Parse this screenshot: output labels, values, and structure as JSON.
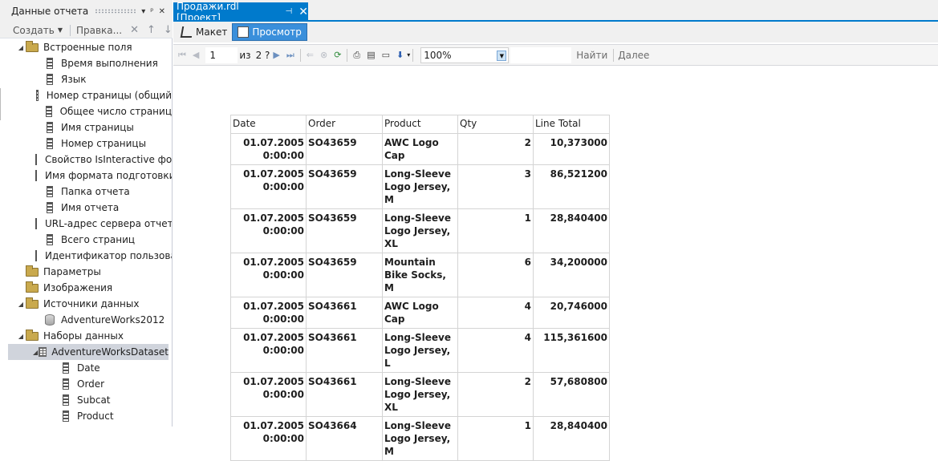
{
  "report_data_panel": {
    "title": "Данные отчета",
    "toolbar": {
      "create": "Создать",
      "edit": "Правка..."
    },
    "tree": [
      {
        "label": "Встроенные поля",
        "level": 1,
        "icon": "folder-icon",
        "expanded": true
      },
      {
        "label": "Время выполнения",
        "level": 2,
        "icon": "field-icon"
      },
      {
        "label": "Язык",
        "level": 2,
        "icon": "field-icon"
      },
      {
        "label": "Номер страницы (общий",
        "level": 2,
        "icon": "field-icon"
      },
      {
        "label": "Общее число страниц",
        "level": 2,
        "icon": "field-icon"
      },
      {
        "label": "Имя страницы",
        "level": 2,
        "icon": "field-icon"
      },
      {
        "label": "Номер страницы",
        "level": 2,
        "icon": "field-icon"
      },
      {
        "label": "Свойство IsInteractive фо",
        "level": 2,
        "icon": "field-icon"
      },
      {
        "label": "Имя формата подготовки",
        "level": 2,
        "icon": "field-icon"
      },
      {
        "label": "Папка отчета",
        "level": 2,
        "icon": "field-icon"
      },
      {
        "label": "Имя отчета",
        "level": 2,
        "icon": "field-icon"
      },
      {
        "label": "URL-адрес сервера отчет",
        "level": 2,
        "icon": "field-icon"
      },
      {
        "label": "Всего страниц",
        "level": 2,
        "icon": "field-icon"
      },
      {
        "label": "Идентификатор пользова",
        "level": 2,
        "icon": "field-icon"
      },
      {
        "label": "Параметры",
        "level": 1,
        "icon": "folder-icon"
      },
      {
        "label": "Изображения",
        "level": 1,
        "icon": "folder-icon"
      },
      {
        "label": "Источники данных",
        "level": 1,
        "icon": "folder-icon",
        "expanded": true
      },
      {
        "label": "AdventureWorks2012",
        "level": 2,
        "icon": "database-icon"
      },
      {
        "label": "Наборы данных",
        "level": 1,
        "icon": "folder-icon",
        "expanded": true
      },
      {
        "label": "AdventureWorksDataset",
        "level": 2,
        "icon": "table-icon",
        "expanded": true,
        "selected": true
      },
      {
        "label": "Date",
        "level": 3,
        "icon": "field-icon"
      },
      {
        "label": "Order",
        "level": 3,
        "icon": "field-icon"
      },
      {
        "label": "Subcat",
        "level": 3,
        "icon": "field-icon"
      },
      {
        "label": "Product",
        "level": 3,
        "icon": "field-icon"
      }
    ]
  },
  "document_tab": {
    "title": "Продажи.rdl [Проект]"
  },
  "mode_bar": {
    "layout": "Макет",
    "preview": "Просмотр"
  },
  "report_toolbar": {
    "page_current": "1",
    "page_of": "из",
    "page_total": "2 ?",
    "zoom": "100%",
    "find": "Найти",
    "next": "Далее"
  },
  "report_table": {
    "headers": [
      "Date",
      "Order",
      "Product",
      "Qty",
      "Line Total"
    ],
    "rows": [
      {
        "date": "01.07.2005 0:00:00",
        "order": "SO43659",
        "product": "AWC Logo Cap",
        "qty": "2",
        "total": "10,373000"
      },
      {
        "date": "01.07.2005 0:00:00",
        "order": "SO43659",
        "product": "Long-Sleeve Logo Jersey, M",
        "qty": "3",
        "total": "86,521200"
      },
      {
        "date": "01.07.2005 0:00:00",
        "order": "SO43659",
        "product": "Long-Sleeve Logo Jersey, XL",
        "qty": "1",
        "total": "28,840400"
      },
      {
        "date": "01.07.2005 0:00:00",
        "order": "SO43659",
        "product": "Mountain Bike Socks, M",
        "qty": "6",
        "total": "34,200000"
      },
      {
        "date": "01.07.2005 0:00:00",
        "order": "SO43661",
        "product": "AWC Logo Cap",
        "qty": "4",
        "total": "20,746000"
      },
      {
        "date": "01.07.2005 0:00:00",
        "order": "SO43661",
        "product": "Long-Sleeve Logo Jersey, L",
        "qty": "4",
        "total": "115,361600"
      },
      {
        "date": "01.07.2005 0:00:00",
        "order": "SO43661",
        "product": "Long-Sleeve Logo Jersey, XL",
        "qty": "2",
        "total": "57,680800"
      },
      {
        "date": "01.07.2005 0:00:00",
        "order": "SO43664",
        "product": "Long-Sleeve Logo Jersey, M",
        "qty": "1",
        "total": "28,840400"
      }
    ]
  },
  "colors": {
    "accent": "#007acc",
    "active_mode": "#3a8fdb",
    "selection": "#d0d4dc"
  }
}
